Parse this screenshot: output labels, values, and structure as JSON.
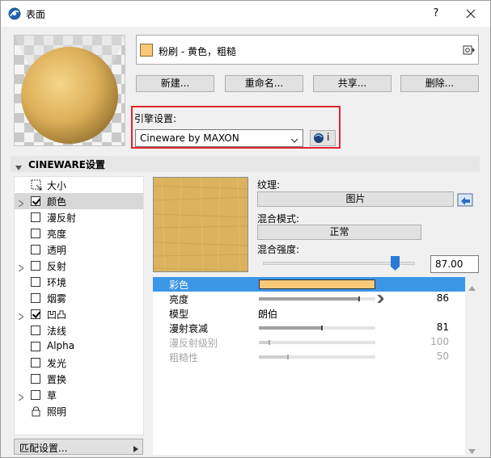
{
  "window": {
    "title": "表面",
    "help_label": "?"
  },
  "material": {
    "name": "粉刷 - 黄色，粗糙",
    "swatch_color": "#f7c979"
  },
  "actions": {
    "new_label": "新建...",
    "rename_label": "重命名...",
    "share_label": "共享...",
    "delete_label": "删除..."
  },
  "engine": {
    "label": "引擎设置:",
    "selected": "Cineware by MAXON",
    "info_label": "i"
  },
  "section": {
    "title": "CINEWARE设置"
  },
  "channels": [
    {
      "label": "大小",
      "kind": "icon",
      "checked": false,
      "expandable": false,
      "selected": false
    },
    {
      "label": "颜色",
      "kind": "checkbox",
      "checked": true,
      "expandable": true,
      "selected": true
    },
    {
      "label": "漫反射",
      "kind": "checkbox",
      "checked": false,
      "expandable": false,
      "selected": false
    },
    {
      "label": "亮度",
      "kind": "checkbox",
      "checked": false,
      "expandable": false,
      "selected": false
    },
    {
      "label": "透明",
      "kind": "checkbox",
      "checked": false,
      "expandable": false,
      "selected": false
    },
    {
      "label": "反射",
      "kind": "checkbox",
      "checked": false,
      "expandable": true,
      "selected": false
    },
    {
      "label": "环境",
      "kind": "checkbox",
      "checked": false,
      "expandable": false,
      "selected": false
    },
    {
      "label": "烟雾",
      "kind": "checkbox",
      "checked": false,
      "expandable": false,
      "selected": false
    },
    {
      "label": "凹凸",
      "kind": "checkbox",
      "checked": true,
      "expandable": true,
      "selected": false
    },
    {
      "label": "法线",
      "kind": "checkbox",
      "checked": false,
      "expandable": false,
      "selected": false
    },
    {
      "label": "Alpha",
      "kind": "checkbox",
      "checked": false,
      "expandable": false,
      "selected": false
    },
    {
      "label": "发光",
      "kind": "checkbox",
      "checked": false,
      "expandable": false,
      "selected": false
    },
    {
      "label": "置换",
      "kind": "checkbox",
      "checked": false,
      "expandable": false,
      "selected": false
    },
    {
      "label": "草",
      "kind": "checkbox",
      "checked": false,
      "expandable": true,
      "selected": false
    },
    {
      "label": "照明",
      "kind": "lock-icon",
      "checked": false,
      "expandable": false,
      "selected": false
    }
  ],
  "match_settings": {
    "label": "匹配设置..."
  },
  "texture": {
    "label": "纹理:",
    "picture_label": "图片",
    "blend_label": "混合模式:",
    "blend_value": "正常",
    "strength_label": "混合强度:",
    "strength_value": "87.00",
    "strength_fraction": 0.87
  },
  "params": [
    {
      "name": "彩色",
      "type": "color",
      "color": "#f7c979",
      "selected": true,
      "disabled": false
    },
    {
      "name": "亮度",
      "type": "bar",
      "fraction": 0.86,
      "value": "86",
      "overflow": true,
      "selected": false,
      "disabled": false
    },
    {
      "name": "模型",
      "type": "text",
      "text": "朗伯",
      "selected": false,
      "disabled": false
    },
    {
      "name": "漫射衰减",
      "type": "bar",
      "fraction": 0.54,
      "value": "81",
      "selected": false,
      "disabled": false
    },
    {
      "name": "漫反射级别",
      "type": "bar",
      "fraction": 0.09,
      "value": "100",
      "selected": false,
      "disabled": true
    },
    {
      "name": "粗糙性",
      "type": "bar",
      "fraction": 0.25,
      "value": "50",
      "selected": false,
      "disabled": true
    }
  ]
}
